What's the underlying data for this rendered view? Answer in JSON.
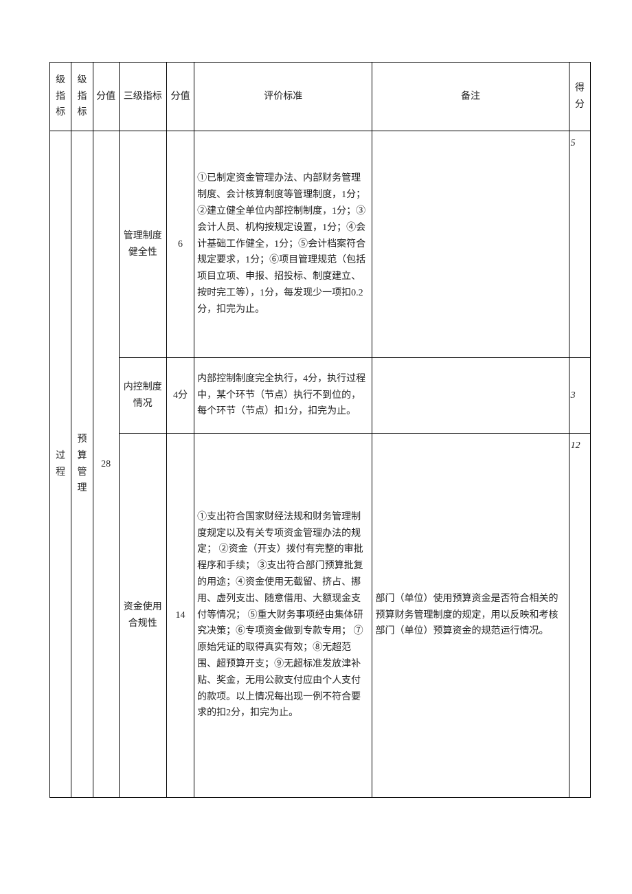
{
  "headers": {
    "col1": "级指标",
    "col2": "级指标",
    "col3": "分值",
    "col4": "三级指标",
    "col5": "分值",
    "col6": "评价标准",
    "col7": "备注",
    "col8": "得分"
  },
  "col1_label": "过程",
  "col2_label": "预算管理",
  "col2_score": "28",
  "rows": [
    {
      "indicator": "管理制度健全性",
      "score": "6",
      "criteria": "①已制定资金管理办法、内部财务管理制度、会计核算制度等管理制度，1分；\n②建立健全单位内部控制制度，1分；③会计人员、机构按规定设置，1分；④会计基础工作健全，1分；⑤会计档案符合规定要求，1分；⑥项目管理规范（包括项目立项、申报、招投标、制度建立、按时完工等），1分，每发现少一项扣0.2分，扣完为止。",
      "remark": "",
      "got": "5"
    },
    {
      "indicator": "内控制度情况",
      "score": "4分",
      "criteria": "内部控制制度完全执行，4分，执行过程中，某个环节（节点）执行不到位的，每个环节（节点）扣1分，扣完为止。",
      "remark": "",
      "got": "3"
    },
    {
      "indicator": "资金使用合规性",
      "score": "14",
      "criteria": "①支出符合国家财经法规和财务管理制度规定以及有关专项资金管理办法的规定；\n②资金（开支）拨付有完整的审批程序和手续；\n③支出符合部门预算批复的用途；④资金使用无截留、挤占、挪用、虚列支出、随意借用、大额现金支付等情况；\n⑤重大财务事项经由集体研究决策；⑥专项资金做到专款专用；\n⑦原始凭证的取得真实有效；⑧无超范围、超预算开支；⑨无超标准发放津补贴、奖金，无用公款支付应由个人支付的款项。以上情况每出现一例不符合要求的扣2分，扣完为止。",
      "remark": "部门（单位）使用预算资金是否符合相关的预算财务管理制度的规定，用以反映和考核部门（单位）预算资金的规范运行情况。",
      "got": "12"
    }
  ]
}
